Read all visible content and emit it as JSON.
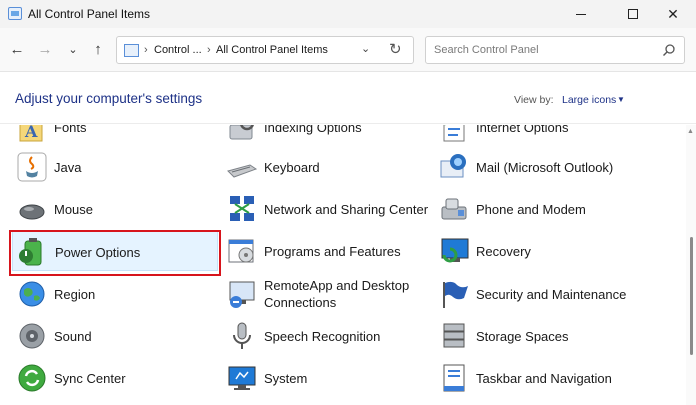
{
  "window": {
    "title": "All Control Panel Items"
  },
  "nav": {
    "breadcrumb_1": "Control ...",
    "breadcrumb_2": "All Control Panel Items",
    "search_placeholder": "Search Control Panel"
  },
  "header": {
    "heading": "Adjust your computer's settings",
    "view_by_label": "View by:",
    "view_by_value": "Large icons"
  },
  "items": [
    {
      "label": "Fonts",
      "icon": "fonts-icon"
    },
    {
      "label": "Indexing Options",
      "icon": "indexing-icon"
    },
    {
      "label": "Internet Options",
      "icon": "internet-options-icon"
    },
    {
      "label": "Java",
      "icon": "java-icon"
    },
    {
      "label": "Keyboard",
      "icon": "keyboard-icon"
    },
    {
      "label": "Mail (Microsoft Outlook)",
      "icon": "mail-icon"
    },
    {
      "label": "Mouse",
      "icon": "mouse-icon"
    },
    {
      "label": "Network and Sharing Center",
      "icon": "network-icon"
    },
    {
      "label": "Phone and Modem",
      "icon": "phone-modem-icon"
    },
    {
      "label": "Power Options",
      "icon": "power-options-icon"
    },
    {
      "label": "Programs and Features",
      "icon": "programs-icon"
    },
    {
      "label": "Recovery",
      "icon": "recovery-icon"
    },
    {
      "label": "Region",
      "icon": "region-icon"
    },
    {
      "label": "RemoteApp and Desktop Connections",
      "icon": "remoteapp-icon"
    },
    {
      "label": "Security and Maintenance",
      "icon": "security-flag-icon"
    },
    {
      "label": "Sound",
      "icon": "sound-icon"
    },
    {
      "label": "Speech Recognition",
      "icon": "microphone-icon"
    },
    {
      "label": "Storage Spaces",
      "icon": "storage-icon"
    },
    {
      "label": "Sync Center",
      "icon": "sync-icon"
    },
    {
      "label": "System",
      "icon": "system-icon"
    },
    {
      "label": "Taskbar and Navigation",
      "icon": "taskbar-icon"
    }
  ],
  "colors": {
    "heading": "#1e3287",
    "highlight": "#d7141c",
    "selected_bg": "#e5f3ff"
  }
}
